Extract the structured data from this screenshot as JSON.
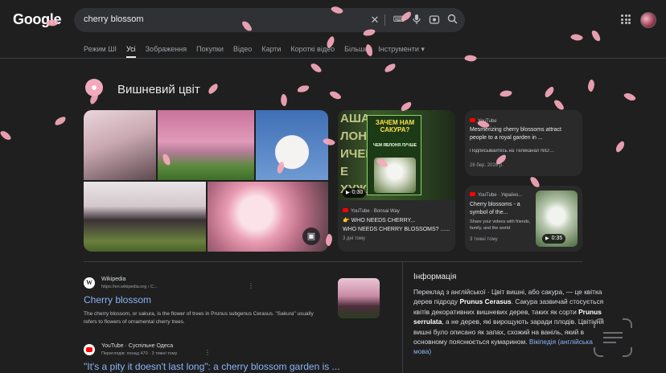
{
  "header": {
    "logo": "Google",
    "query": "cherry blossom"
  },
  "tabs": [
    {
      "label": "Режим ШІ",
      "active": false
    },
    {
      "label": "Усі",
      "active": true
    },
    {
      "label": "Зображення",
      "active": false
    },
    {
      "label": "Покупки",
      "active": false
    },
    {
      "label": "Відео",
      "active": false
    },
    {
      "label": "Карти",
      "active": false
    },
    {
      "label": "Короткі відео",
      "active": false
    },
    {
      "label": "Більше",
      "active": false
    },
    {
      "label": "Інструменти",
      "active": false
    }
  ],
  "heading": "Вишневий цвіт",
  "videos": [
    {
      "thumb_side_text": "АША ЛОН ИЧЕМ Е ХУЖ",
      "poster_title": "ЗАЧЕМ НАМ САКУРА?",
      "poster_subtitle": "ЧЕМ ЯБЛОНЯ ЛУЧШЕ",
      "duration": "0:30",
      "source": "YouTube · Bonsai Way",
      "title": "👉 WHO NEEDS CHERRY...",
      "title2": "WHO NEEDS CHERRY BLOSSOMS? ......",
      "time": "3 дні тому"
    },
    {
      "source": "YouTube",
      "title": "Mesmerizing cherry blossoms attract people to a royal garden in ...",
      "subtitle": "Подписывайтесь на Телеканал NID:...",
      "time": "26 бер. 2026 р."
    },
    {
      "source": "YouTube · Україно...",
      "title": "Cherry blossoms - a symbol of the...",
      "desc": "Share your videos with friends, family, and the world",
      "duration": "0:35",
      "time": "3 тижні тому"
    }
  ],
  "results": [
    {
      "site": "Wikipedia",
      "url": "https://en.wikipedia.org › C...",
      "title": "Cherry blossom",
      "snippet": "The cherry blossom, or sakura, is the flower of trees in Prunus subgenus Cerasus. \"Sakura\" usually refers to flowers of ornamental cherry trees."
    },
    {
      "site": "YouTube · Суспільне Одеса",
      "url": "Переглядів: понад 470 · 3 тижні тому",
      "title": "\"It's a pity it doesn't last long\": a cherry blossom garden is ..."
    }
  ],
  "info": {
    "heading": "Інформація",
    "text1": "Переклад з англійської · Цвіт вишні, або сакура, — це квітка дерев підроду ",
    "bold1": "Prunus Cerasus",
    "text2": ". Сакура зазвичай стосується квітів декоративних вишневих дерев, таких як сорти ",
    "bold2": "Prunus serrulata",
    "text3": ", а не дерев, які вирощують заради плодів. Цвітіння вишні було описано як запах, схожий на ваніль, який в основному пояснюється кумарином. ",
    "link": "Вікіпедія (англійська мова)"
  },
  "icons": {
    "clear": "close-icon",
    "keyboard": "keyboard-icon",
    "voice": "mic-icon",
    "lens": "camera-lens-icon",
    "search": "search-icon",
    "apps": "apps-grid-icon",
    "expand": "image-expand-icon"
  },
  "colors": {
    "background": "#1f1f1f",
    "link": "#8ab4f8",
    "petal": "#f7a9bc"
  }
}
